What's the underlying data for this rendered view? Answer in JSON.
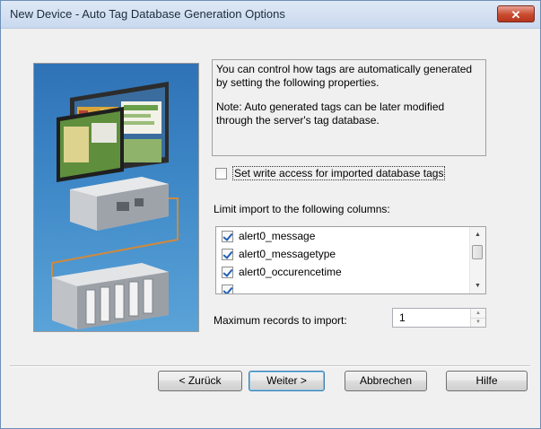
{
  "window": {
    "title": "New Device - Auto Tag Database Generation Options",
    "close_label": "✕"
  },
  "info": {
    "paragraph1": "You can control how tags are automatically generated by setting the following properties.",
    "paragraph2": "Note: Auto generated tags can be later modified through the server's tag database."
  },
  "write_access": {
    "label": "Set write access for imported database tags",
    "checked": false
  },
  "columns": {
    "label": "Limit import to the following columns:",
    "items": [
      {
        "label": "alert0_message",
        "checked": true
      },
      {
        "label": "alert0_messagetype",
        "checked": true
      },
      {
        "label": "alert0_occurencetime",
        "checked": true
      }
    ]
  },
  "max_records": {
    "label": "Maximum records to import:",
    "value": "1"
  },
  "buttons": {
    "back": "< Zurück",
    "next": "Weiter >",
    "cancel": "Abbrechen",
    "help": "Hilfe"
  }
}
